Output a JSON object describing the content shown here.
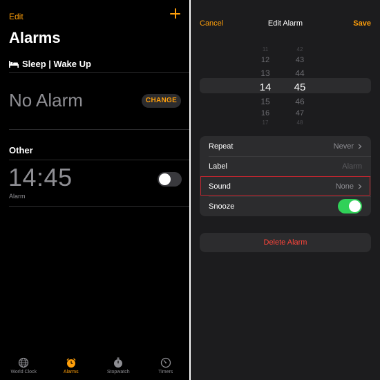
{
  "left": {
    "edit_label": "Edit",
    "title": "Alarms",
    "sleep_section": "Sleep | Wake Up",
    "no_alarm": "No Alarm",
    "change_label": "CHANGE",
    "other_section": "Other",
    "alarm": {
      "time": "14:45",
      "label": "Alarm",
      "enabled": false
    }
  },
  "tabs": [
    {
      "label": "World Clock",
      "icon": "globe-icon",
      "active": false
    },
    {
      "label": "Alarms",
      "icon": "alarm-clock-icon",
      "active": true
    },
    {
      "label": "Stopwatch",
      "icon": "stopwatch-icon",
      "active": false
    },
    {
      "label": "Timers",
      "icon": "timer-icon",
      "active": false
    }
  ],
  "edit_alarm": {
    "cancel_label": "Cancel",
    "title": "Edit Alarm",
    "save_label": "Save",
    "picker": {
      "hours": [
        "11",
        "12",
        "13",
        "14",
        "15",
        "16",
        "17"
      ],
      "minutes": [
        "42",
        "43",
        "44",
        "45",
        "46",
        "47",
        "48"
      ],
      "selected_hour": "14",
      "selected_minute": "45"
    },
    "rows": {
      "repeat": {
        "label": "Repeat",
        "value": "Never"
      },
      "label": {
        "label": "Label",
        "placeholder": "Alarm"
      },
      "sound": {
        "label": "Sound",
        "value": "None"
      },
      "snooze": {
        "label": "Snooze",
        "enabled": true
      }
    },
    "delete_label": "Delete Alarm"
  },
  "colors": {
    "accent": "#ff9f0a",
    "toggle_on": "#30d158",
    "destructive": "#ff453a",
    "highlight_outline": "#c0262f"
  }
}
